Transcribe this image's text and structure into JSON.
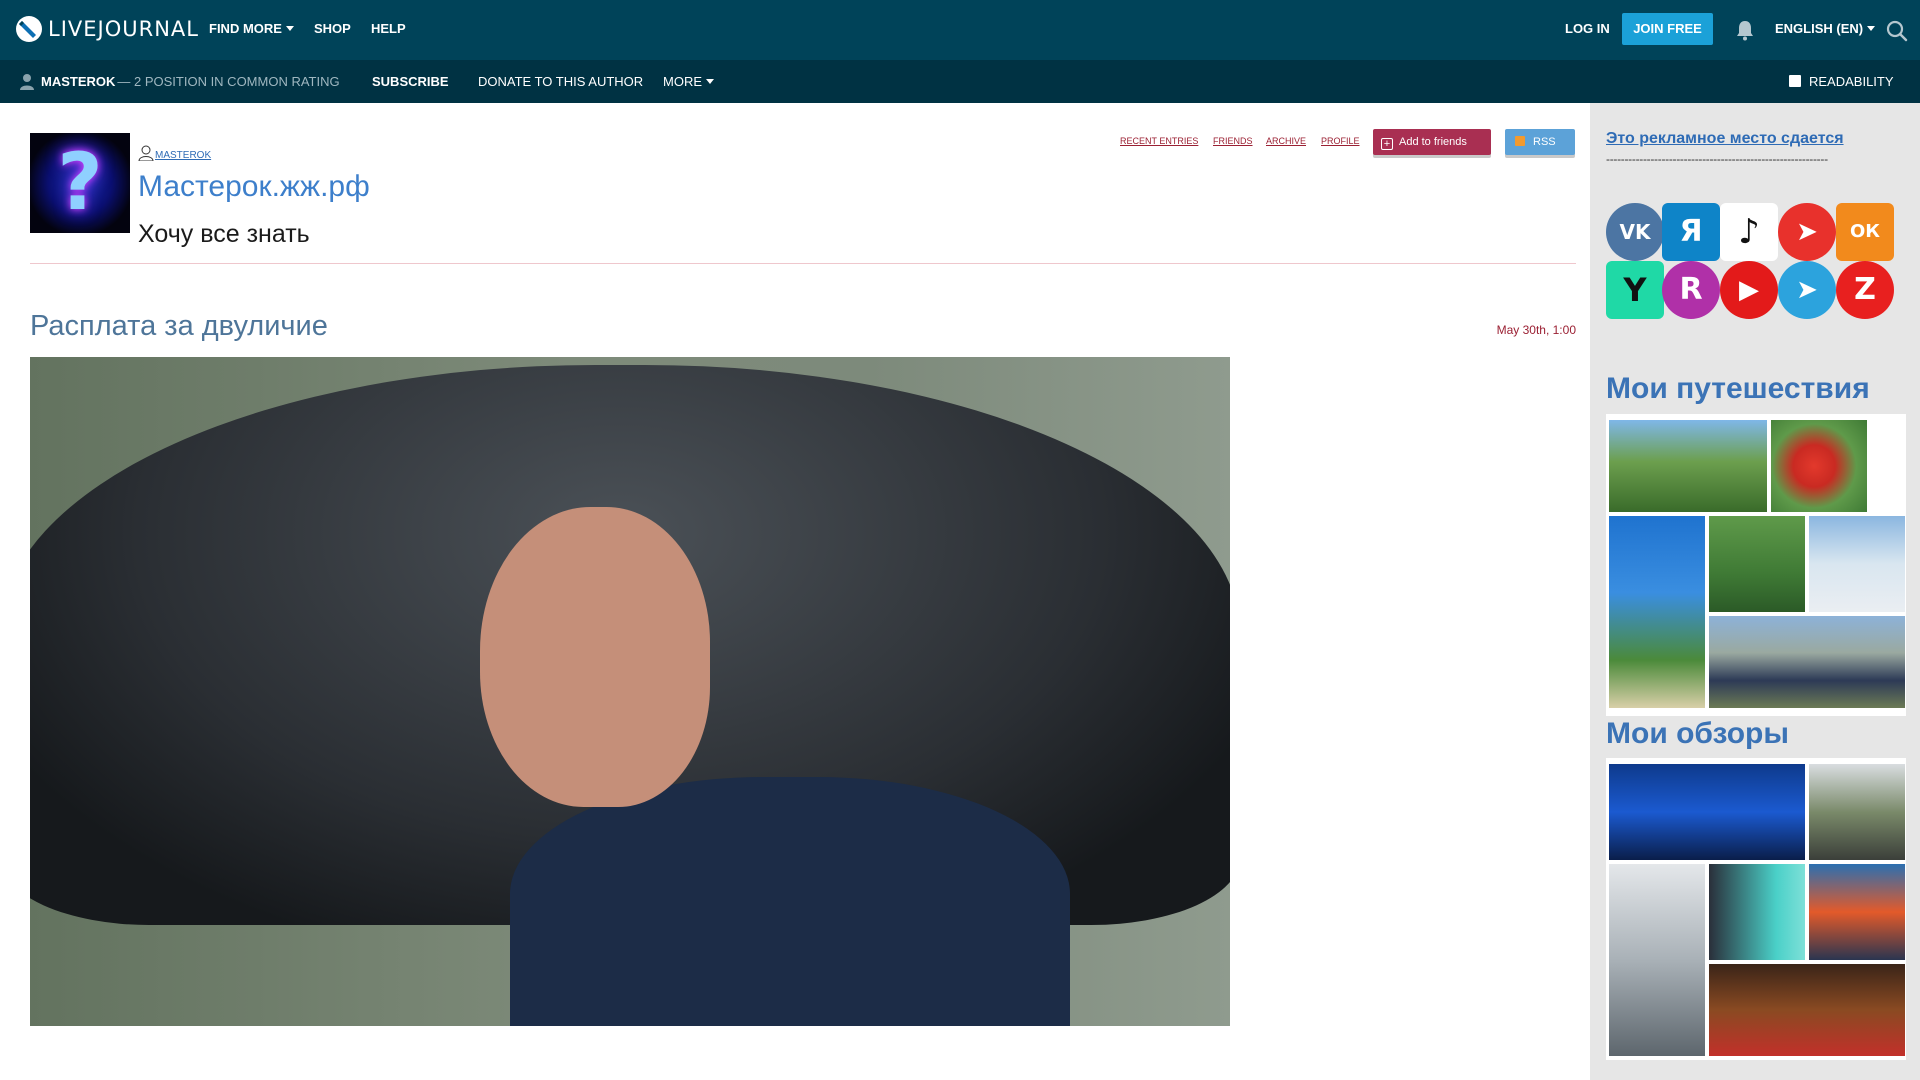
{
  "header": {
    "logo_text": "LIVEJOURNAL",
    "nav": [
      "FIND MORE",
      "SHOP",
      "HELP"
    ],
    "login_label": "LOG IN",
    "join_label": "JOIN FREE",
    "language_label": "ENGLISH (EN)"
  },
  "subbar": {
    "username": "MASTEROK",
    "rating_text": "— 2 POSITION IN COMMON RATING",
    "subscribe_label": "SUBSCRIBE",
    "donate_label": "DONATE TO THIS AUTHOR",
    "more_label": "MORE",
    "readability_label": "READABILITY"
  },
  "journal": {
    "owner": "MASTEROK",
    "title": "Мастерок.жж.рф",
    "subtitle": "Хочу все знать",
    "links": [
      "RECENT ENTRIES",
      "FRIENDS",
      "ARCHIVE",
      "PROFILE"
    ],
    "add_friends_label": "Add to friends",
    "rss_label": "RSS",
    "avatar_glyph": "?"
  },
  "post": {
    "title": "Расплата за двуличие",
    "date": "May 30th, 1:00"
  },
  "sidebar": {
    "ad_text": "Это рекламное место сдается",
    "ad_dashes": "------------------------------------------------------------",
    "social": [
      {
        "name": "vk-icon",
        "glyph": "VK",
        "color": "#4c75a3"
      },
      {
        "name": "yandex-zen-icon",
        "glyph": "Я",
        "color": "#0e84c8"
      },
      {
        "name": "tiktok-icon",
        "glyph": "♪",
        "color": "#ffffff"
      },
      {
        "name": "telegram-arrow-icon",
        "glyph": "➤",
        "color": "#e8312c"
      },
      {
        "name": "odnoklassniki-icon",
        "glyph": "ОК",
        "color": "#f28a1c"
      },
      {
        "name": "yappy-icon",
        "glyph": "Y",
        "color": "#1fd9a6"
      },
      {
        "name": "rutube-icon",
        "glyph": "R",
        "color": "#b030a8"
      },
      {
        "name": "youtube-icon",
        "glyph": "▶",
        "color": "#e31a1a"
      },
      {
        "name": "telegram-icon",
        "glyph": "➤",
        "color": "#2ca3dd"
      },
      {
        "name": "zen-icon",
        "glyph": "Z",
        "color": "#e8201f"
      }
    ],
    "travel_title": "Мои путешествия",
    "reviews_title": "Мои обзоры"
  },
  "colors": {
    "topbar": "#004359",
    "subbar": "#003243",
    "accent": "#1ba1d8",
    "link": "#3d7fcb",
    "date": "#9b2033"
  }
}
